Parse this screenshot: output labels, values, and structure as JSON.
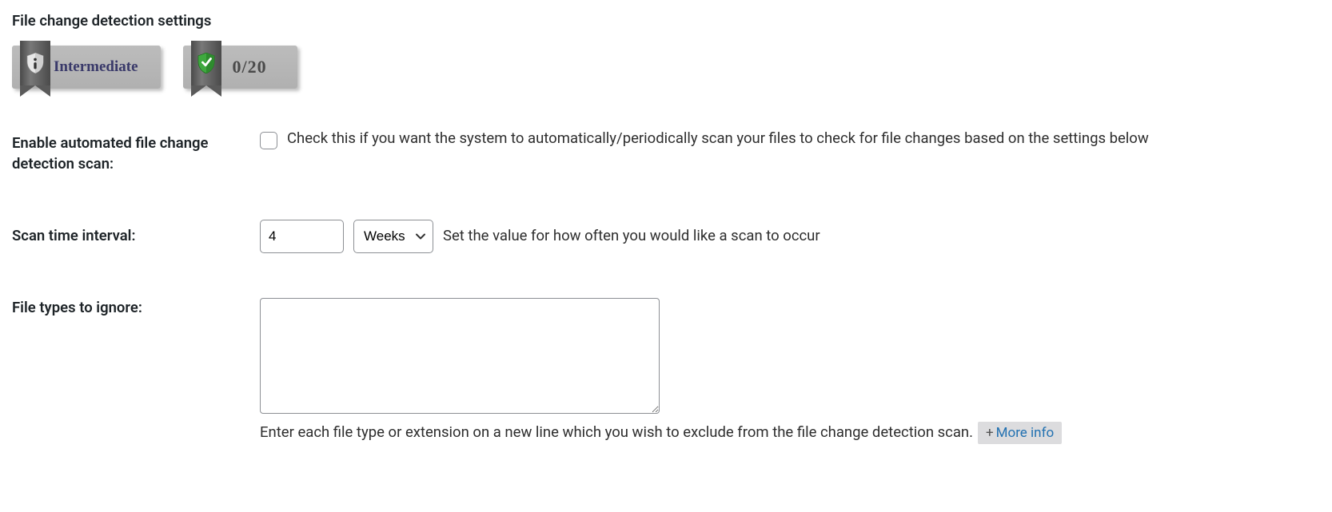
{
  "title": "File change detection settings",
  "badges": {
    "level_label": "Intermediate",
    "score": "0/20"
  },
  "rows": {
    "enable_scan": {
      "label": "Enable automated file change detection scan:",
      "help": "Check this if you want the system to automatically/periodically scan your files to check for file changes based on the settings below"
    },
    "interval": {
      "label": "Scan time interval:",
      "value": "4",
      "unit": "Weeks",
      "help": "Set the value for how often you would like a scan to occur"
    },
    "ignore_types": {
      "label": "File types to ignore:",
      "value": "",
      "help": "Enter each file type or extension on a new line which you wish to exclude from the file change detection scan.",
      "more_info": "More info"
    }
  }
}
